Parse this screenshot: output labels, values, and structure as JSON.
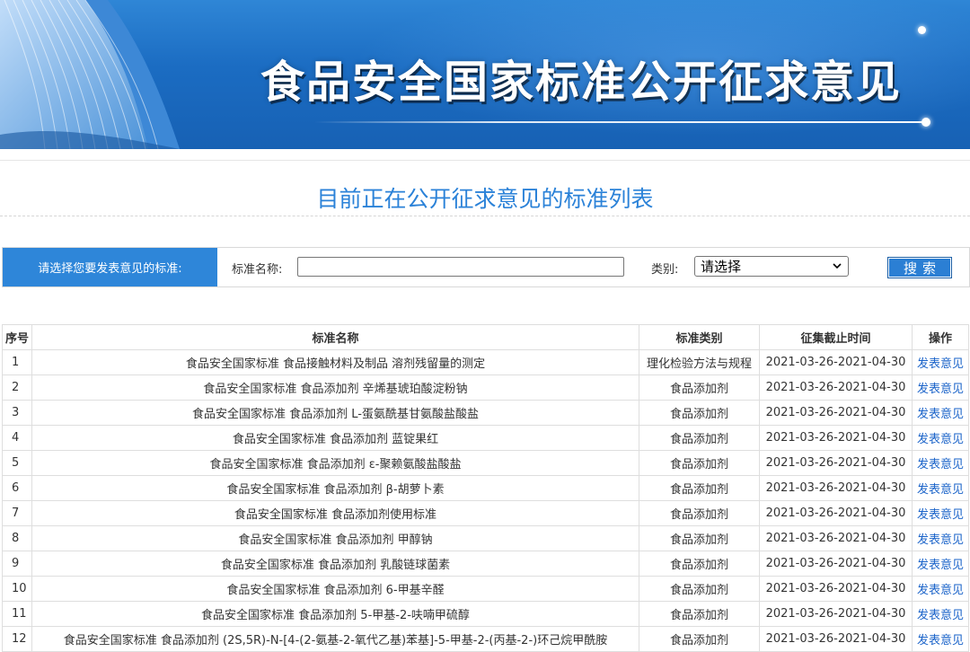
{
  "banner": {
    "title": "食品安全国家标准公开征求意见"
  },
  "page_title": "目前正在公开征求意见的标准列表",
  "search": {
    "tag_label": "请选择您要发表意见的标准:",
    "name_label": "标准名称:",
    "name_value": "",
    "category_label": "类别:",
    "category_selected": "请选择",
    "button_label": "搜索"
  },
  "table": {
    "headers": [
      "序号",
      "标准名称",
      "标准类别",
      "征集截止时间",
      "操作"
    ],
    "rows": [
      {
        "no": "1",
        "name": "食品安全国家标准 食品接触材料及制品 溶剂残留量的测定",
        "category": "理化检验方法与规程",
        "deadline": "2021-03-26-2021-04-30",
        "action": "发表意见"
      },
      {
        "no": "2",
        "name": "食品安全国家标准 食品添加剂 辛烯基琥珀酸淀粉钠",
        "category": "食品添加剂",
        "deadline": "2021-03-26-2021-04-30",
        "action": "发表意见"
      },
      {
        "no": "3",
        "name": "食品安全国家标准 食品添加剂 L-蛋氨酰基甘氨酸盐酸盐",
        "category": "食品添加剂",
        "deadline": "2021-03-26-2021-04-30",
        "action": "发表意见"
      },
      {
        "no": "4",
        "name": "食品安全国家标准 食品添加剂 蓝锭果红",
        "category": "食品添加剂",
        "deadline": "2021-03-26-2021-04-30",
        "action": "发表意见"
      },
      {
        "no": "5",
        "name": "食品安全国家标准 食品添加剂 ε-聚赖氨酸盐酸盐",
        "category": "食品添加剂",
        "deadline": "2021-03-26-2021-04-30",
        "action": "发表意见"
      },
      {
        "no": "6",
        "name": "食品安全国家标准 食品添加剂 β-胡萝卜素",
        "category": "食品添加剂",
        "deadline": "2021-03-26-2021-04-30",
        "action": "发表意见"
      },
      {
        "no": "7",
        "name": "食品安全国家标准 食品添加剂使用标准",
        "category": "食品添加剂",
        "deadline": "2021-03-26-2021-04-30",
        "action": "发表意见"
      },
      {
        "no": "8",
        "name": "食品安全国家标准 食品添加剂 甲醇钠",
        "category": "食品添加剂",
        "deadline": "2021-03-26-2021-04-30",
        "action": "发表意见"
      },
      {
        "no": "9",
        "name": "食品安全国家标准 食品添加剂 乳酸链球菌素",
        "category": "食品添加剂",
        "deadline": "2021-03-26-2021-04-30",
        "action": "发表意见"
      },
      {
        "no": "10",
        "name": "食品安全国家标准 食品添加剂 6-甲基辛醛",
        "category": "食品添加剂",
        "deadline": "2021-03-26-2021-04-30",
        "action": "发表意见"
      },
      {
        "no": "11",
        "name": "食品安全国家标准 食品添加剂 5-甲基-2-呋喃甲硫醇",
        "category": "食品添加剂",
        "deadline": "2021-03-26-2021-04-30",
        "action": "发表意见"
      },
      {
        "no": "12",
        "name": "食品安全国家标准 食品添加剂 (2S,5R)-N-[4-(2-氨基-2-氧代乙基)苯基]-5-甲基-2-(丙基-2-)环己烷甲酰胺",
        "category": "食品添加剂",
        "deadline": "2021-03-26-2021-04-30",
        "action": "发表意见"
      }
    ]
  },
  "colors": {
    "accent": "#2e86d9",
    "title_blue": "#2b82d8",
    "link_blue": "#1a63c9",
    "banner_blue": "#1b6cc2"
  },
  "icons": {
    "select_arrow": "chevron-down-icon"
  }
}
